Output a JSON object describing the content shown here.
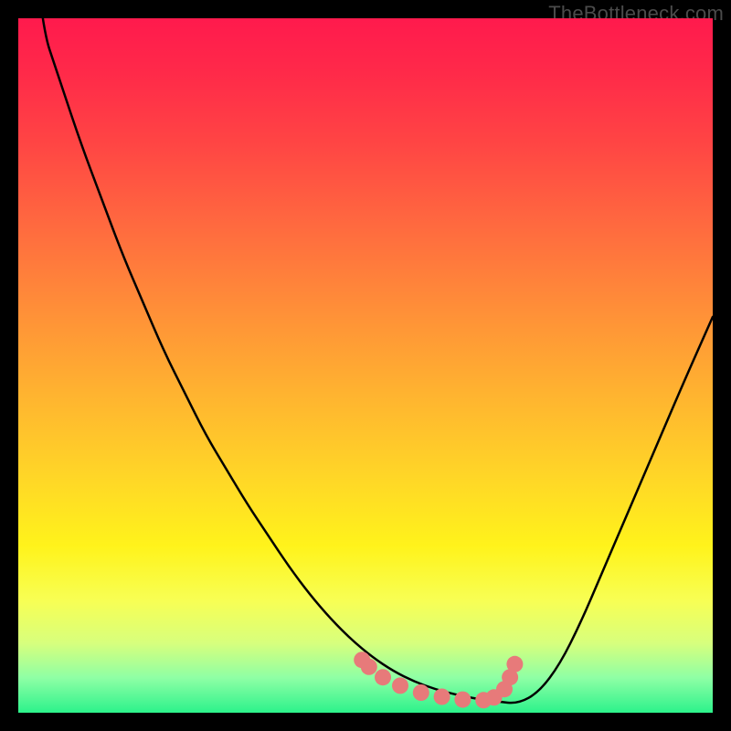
{
  "watermark": "TheBottleneck.com",
  "colors": {
    "gradient_top": "#ff1a4d",
    "gradient_mid": "#ffd627",
    "gradient_bottom": "#2cf28b",
    "curve": "#000000",
    "dot_fill": "#e77a7a",
    "dot_stroke": "#000000",
    "frame": "#000000"
  },
  "chart_data": {
    "type": "line",
    "title": "",
    "xlabel": "",
    "ylabel": "",
    "xlim": [
      0,
      100
    ],
    "ylim": [
      0,
      100
    ],
    "grid": false,
    "series": [
      {
        "name": "bottleneck-curve",
        "x": [
          0,
          3,
          6,
          9,
          12,
          15,
          18,
          21,
          24,
          27,
          30,
          33,
          36,
          39,
          42,
          45,
          48,
          51,
          54,
          57,
          60,
          63,
          66,
          69,
          72,
          75,
          78,
          81,
          84,
          87,
          90,
          93,
          96,
          100
        ],
        "values": [
          140,
          100,
          91,
          82,
          74,
          66,
          59,
          52,
          46,
          40,
          35,
          30,
          25.5,
          21,
          17,
          13.5,
          10.5,
          8,
          6,
          4.5,
          3.4,
          2.6,
          2,
          1.6,
          1.3,
          3,
          7,
          13,
          20,
          27,
          34,
          41,
          48,
          57
        ]
      }
    ],
    "highlight_points": {
      "name": "sweet-spot-dots",
      "x": [
        49.5,
        50.5,
        52.5,
        55,
        58,
        61,
        64,
        67,
        68.5,
        70,
        70.8,
        71.5
      ],
      "y": [
        7.6,
        6.6,
        5.1,
        3.9,
        2.9,
        2.3,
        1.9,
        1.8,
        2.2,
        3.4,
        5.1,
        7.0
      ]
    }
  }
}
